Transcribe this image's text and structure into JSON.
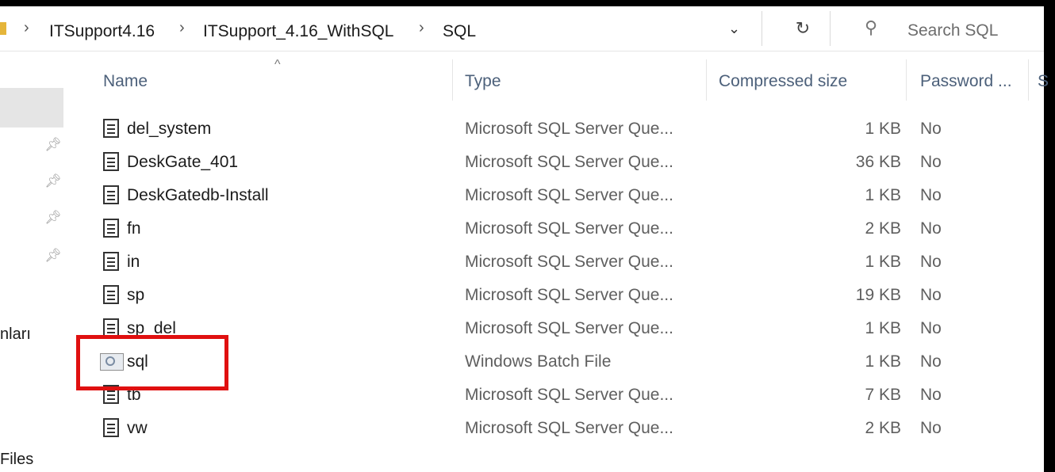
{
  "address_bar": {
    "breadcrumbs": [
      "ITSupport4.16",
      "ITSupport_4.16_WithSQL",
      "SQL"
    ],
    "search_placeholder": "Search SQL"
  },
  "sidebar": {
    "labels": [
      "nları",
      "Files"
    ]
  },
  "columns": {
    "name": "Name",
    "type": "Type",
    "compressed_size": "Compressed size",
    "password": "Password ...",
    "extra": "S"
  },
  "files": [
    {
      "name": "del_system",
      "type": "Microsoft SQL Server Que...",
      "size": "1 KB",
      "password": "No",
      "icon": "sql-script-icon"
    },
    {
      "name": "DeskGate_401",
      "type": "Microsoft SQL Server Que...",
      "size": "36 KB",
      "password": "No",
      "icon": "sql-script-icon"
    },
    {
      "name": "DeskGatedb-Install",
      "type": "Microsoft SQL Server Que...",
      "size": "1 KB",
      "password": "No",
      "icon": "sql-script-icon"
    },
    {
      "name": "fn",
      "type": "Microsoft SQL Server Que...",
      "size": "2 KB",
      "password": "No",
      "icon": "sql-script-icon"
    },
    {
      "name": "in",
      "type": "Microsoft SQL Server Que...",
      "size": "1 KB",
      "password": "No",
      "icon": "sql-script-icon"
    },
    {
      "name": "sp",
      "type": "Microsoft SQL Server Que...",
      "size": "19 KB",
      "password": "No",
      "icon": "sql-script-icon"
    },
    {
      "name": "sp_del",
      "type": "Microsoft SQL Server Que...",
      "size": "1 KB",
      "password": "No",
      "icon": "sql-script-icon"
    },
    {
      "name": "sql",
      "type": "Windows Batch File",
      "size": "1 KB",
      "password": "No",
      "icon": "batch-file-icon"
    },
    {
      "name": "tb",
      "type": "Microsoft SQL Server Que...",
      "size": "7 KB",
      "password": "No",
      "icon": "sql-script-icon"
    },
    {
      "name": "vw",
      "type": "Microsoft SQL Server Que...",
      "size": "2 KB",
      "password": "No",
      "icon": "sql-script-icon"
    }
  ],
  "highlight_color": "#e01010"
}
